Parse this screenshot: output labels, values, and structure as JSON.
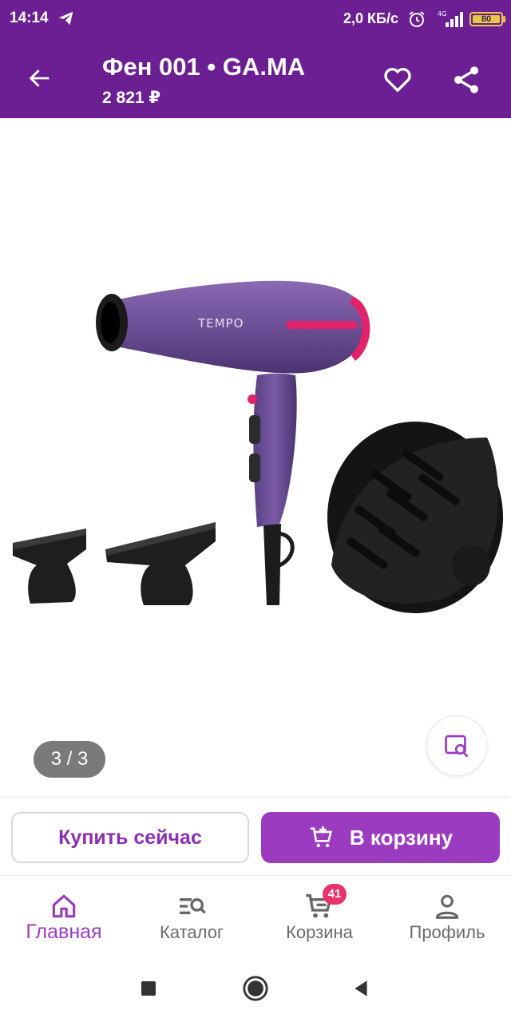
{
  "status_bar": {
    "time": "14:14",
    "speed": "2,0 КБ/с",
    "network": "4G",
    "battery": "80"
  },
  "header": {
    "title": "Фен 001 • GA.MA",
    "price": "2 821 ₽"
  },
  "product": {
    "brand_text": "TEMPO",
    "image_counter": "3 / 3"
  },
  "actions": {
    "buy_now_label": "Купить сейчас",
    "add_to_cart_label": "В корзину"
  },
  "bottom_nav": {
    "items": [
      {
        "label": "Главная",
        "icon": "home-icon",
        "active": true
      },
      {
        "label": "Каталог",
        "icon": "catalog-search-icon",
        "active": false
      },
      {
        "label": "Корзина",
        "icon": "cart-icon",
        "active": false,
        "badge": "41"
      },
      {
        "label": "Профиль",
        "icon": "profile-icon",
        "active": false
      }
    ]
  },
  "colors": {
    "primary": "#6b1f93",
    "accent": "#9b3cc0",
    "badge": "#e9336c",
    "counter_bg": "#7a7a7a"
  }
}
